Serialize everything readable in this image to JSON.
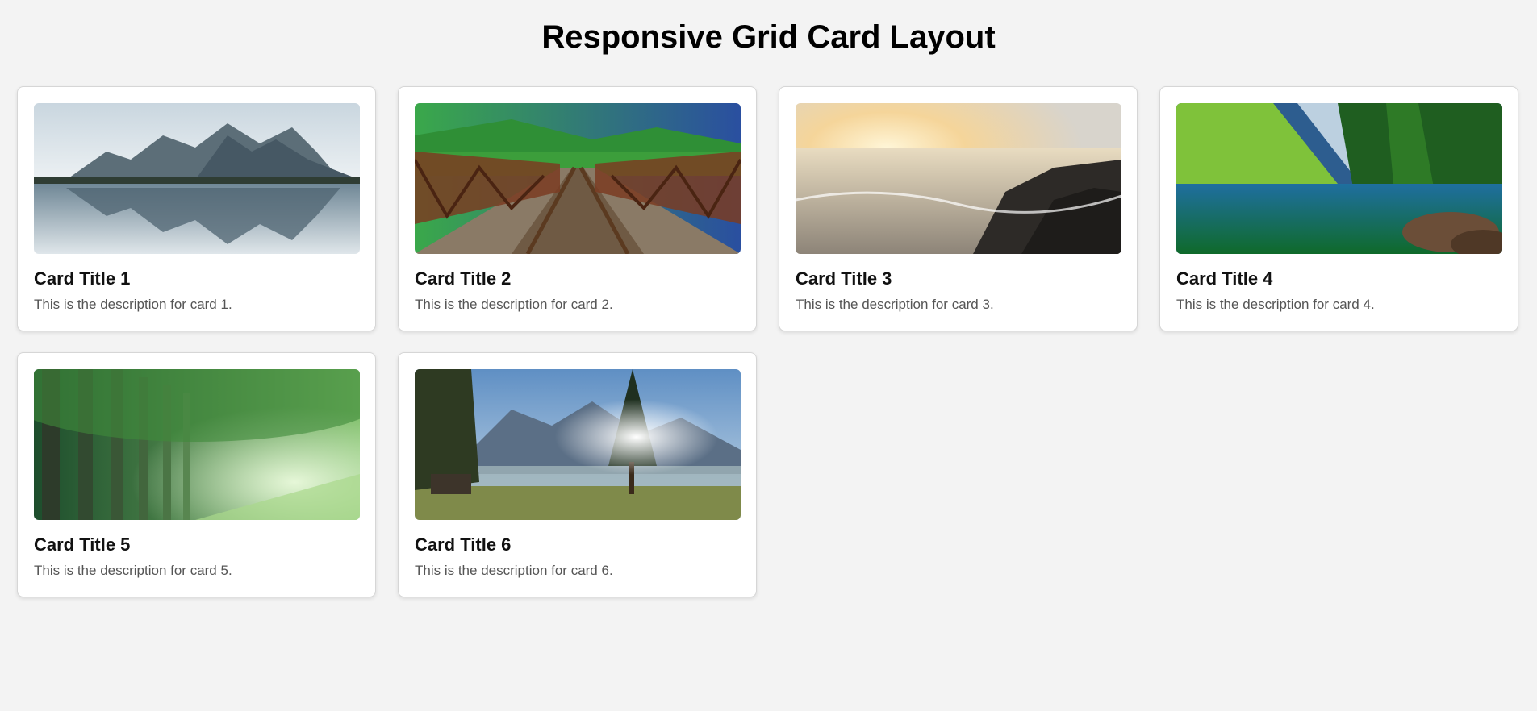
{
  "page": {
    "title": "Responsive Grid Card Layout",
    "background": "#f3f3f3"
  },
  "cards": [
    {
      "title": "Card Title 1",
      "description": "This is the description for card 1.",
      "image": "mountain-lake-reflection"
    },
    {
      "title": "Card Title 2",
      "description": "This is the description for card 2.",
      "image": "railway-bridge-tracks"
    },
    {
      "title": "Card Title 3",
      "description": "This is the description for card 3.",
      "image": "sunset-rocky-shore"
    },
    {
      "title": "Card Title 4",
      "description": "This is the description for card 4.",
      "image": "green-valley-lake"
    },
    {
      "title": "Card Title 5",
      "description": "This is the description for card 5.",
      "image": "forest-tree-avenue"
    },
    {
      "title": "Card Title 6",
      "description": "This is the description for card 6.",
      "image": "alpine-meadow-sunrise"
    }
  ]
}
